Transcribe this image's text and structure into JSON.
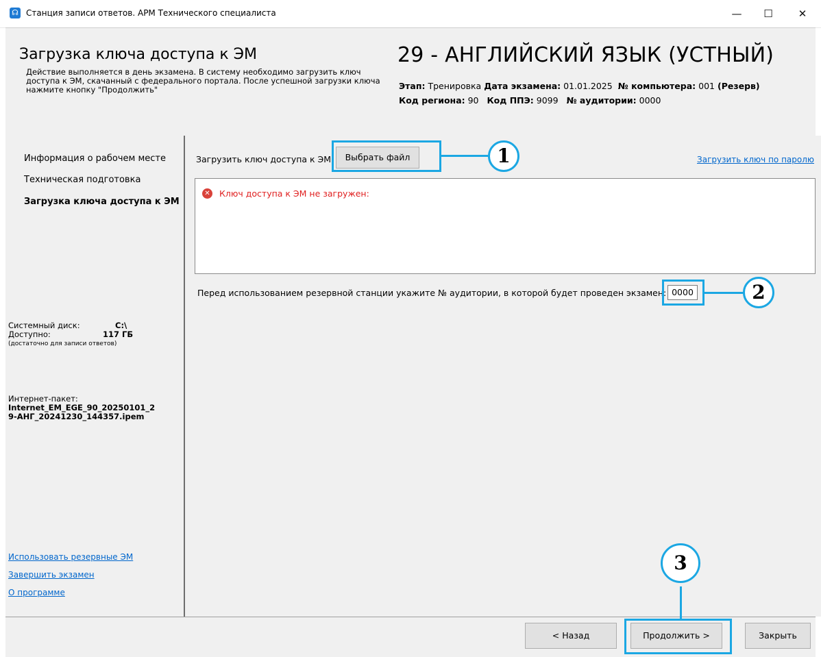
{
  "window": {
    "title": "Станция записи ответов. АРМ Технического специалиста",
    "minimize": "—",
    "maximize": "☐",
    "close": "✕"
  },
  "header": {
    "title": "Загрузка ключа доступа к ЭМ",
    "description": "Действие выполняется в день экзамена. В систему необходимо загрузить ключ доступа к ЭМ, скачанный с федерального портала. После успешной загрузки ключа нажмите кнопку \"Продолжить\"",
    "exam_title": "29 - АНГЛИЙСКИЙ ЯЗЫК (УСТНЫЙ)",
    "stage_label": "Этап:",
    "stage_value": "Тренировка",
    "date_label": "Дата экзамена:",
    "date_value": "01.01.2025",
    "computer_label": "№ компьютера:",
    "computer_value": "001",
    "reserve_value": "(Резерв)",
    "region_label": "Код региона:",
    "region_value": "90",
    "ppe_label": "Код ППЭ:",
    "ppe_value": "9099",
    "room_label": "№ аудитории:",
    "room_value": "0000"
  },
  "sidebar": {
    "items": [
      {
        "label": "Информация о рабочем месте"
      },
      {
        "label": "Техническая подготовка"
      },
      {
        "label": "Загрузка ключа доступа к ЭМ"
      }
    ],
    "disk_label": "Системный диск:",
    "disk_value": "C:\\",
    "free_label": "Доступно:",
    "free_value": "117 ГБ",
    "free_note": "(достаточно для записи ответов)",
    "package_label": "Интернет-пакет:",
    "package_value_line1": "Internet_EM_EGE_90_20250101_2",
    "package_value_line2": "9-АНГ_20241230_144357.ipem",
    "links": [
      "Использовать резервные ЭМ",
      "Завершить экзамен",
      "О программе"
    ]
  },
  "main": {
    "upload_label": "Загрузить ключ доступа к ЭМ:",
    "choose_file_button": "Выбрать файл",
    "load_by_password_link": "Загрузить ключ по паролю",
    "error_message": "Ключ доступа к ЭМ не загружен:",
    "reserve_prompt": "Перед использованием резервной станции укажите № аудитории, в которой будет проведен экзамен:",
    "room_input_value": "0000"
  },
  "footer": {
    "back_button": "< Назад",
    "continue_button": "Продолжить >",
    "close_button": "Закрыть"
  },
  "callouts": [
    "1",
    "2",
    "3"
  ],
  "colors": {
    "highlight": "#1ba7e3",
    "error": "#e02020",
    "link": "#0066cc",
    "panel": "#f0f0f0"
  }
}
